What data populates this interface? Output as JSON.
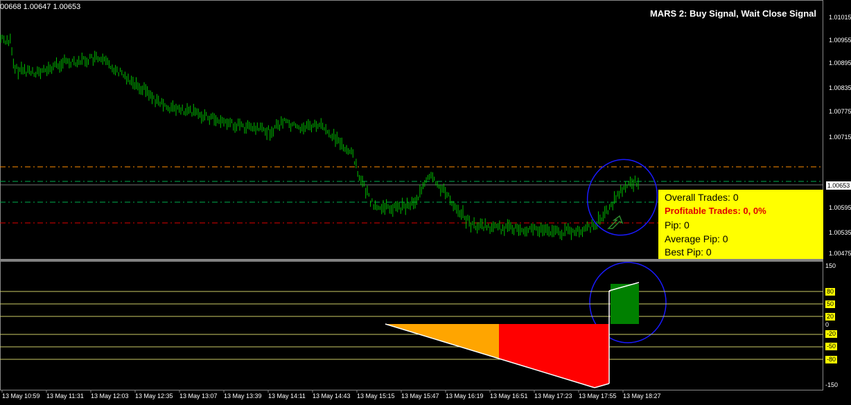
{
  "header": {
    "ohlc": "00668 1.00647 1.00653",
    "signal_text": "MARS 2: Buy Signal, Wait Close Signal"
  },
  "price_axis": {
    "labels": [
      "1.01015",
      "1.00955",
      "1.00895",
      "1.00835",
      "1.00775",
      "1.00715",
      "1.00595",
      "1.00535",
      "1.00475"
    ],
    "current_price": "1.00653"
  },
  "info_panel": {
    "overall_trades": "Overall Trades: 0",
    "profitable_trades": "Profitable Trades: 0, 0%",
    "pip": "Pip: 0",
    "average_pip": "Average Pip: 0",
    "best_pip": "Best Pip: 0"
  },
  "indicator_axis": {
    "top": "150",
    "bottom": "-150",
    "zero": "0",
    "levels": [
      "80",
      "50",
      "20",
      "-20",
      "-50",
      "-80"
    ]
  },
  "time_axis": [
    "13 May 10:59",
    "13 May 11:31",
    "13 May 12:03",
    "13 May 12:35",
    "13 May 13:07",
    "13 May 13:39",
    "13 May 14:11",
    "13 May 14:43",
    "13 May 15:15",
    "13 May 15:47",
    "13 May 16:19",
    "13 May 16:51",
    "13 May 17:23",
    "13 May 17:55",
    "13 May 18:27"
  ],
  "colors": {
    "candles": "#00c000",
    "orange_line": "#ff8c00",
    "green_line": "#00b050",
    "red_line": "#e00000",
    "panel_bg": "#ffff00",
    "annotation": "#1a1aff"
  }
}
